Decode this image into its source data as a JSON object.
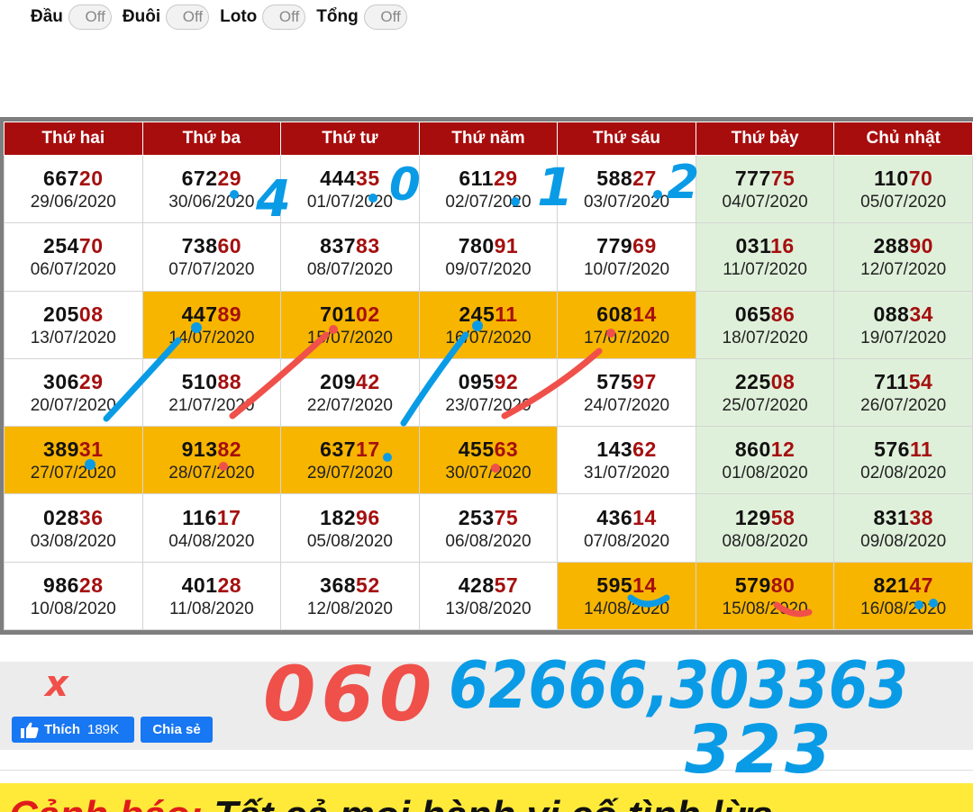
{
  "toggles": [
    {
      "label": "Đầu",
      "state": "Off"
    },
    {
      "label": "Đuôi",
      "state": "Off"
    },
    {
      "label": "Loto",
      "state": "Off"
    },
    {
      "label": "Tổng",
      "state": "Off"
    }
  ],
  "table": {
    "headers": [
      "Thứ hai",
      "Thứ ba",
      "Thứ tư",
      "Thứ năm",
      "Thứ sáu",
      "Thứ bảy",
      "Chủ nhật"
    ],
    "rows": [
      [
        {
          "head": "667",
          "tail": "20",
          "date": "29/06/2020"
        },
        {
          "head": "672",
          "tail": "29",
          "date": "30/06/2020"
        },
        {
          "head": "444",
          "tail": "35",
          "date": "01/07/2020"
        },
        {
          "head": "611",
          "tail": "29",
          "date": "02/07/2020"
        },
        {
          "head": "588",
          "tail": "27",
          "date": "03/07/2020"
        },
        {
          "head": "777",
          "tail": "75",
          "date": "04/07/2020"
        },
        {
          "head": "110",
          "tail": "70",
          "date": "05/07/2020"
        }
      ],
      [
        {
          "head": "254",
          "tail": "70",
          "date": "06/07/2020"
        },
        {
          "head": "738",
          "tail": "60",
          "date": "07/07/2020"
        },
        {
          "head": "837",
          "tail": "83",
          "date": "08/07/2020"
        },
        {
          "head": "780",
          "tail": "91",
          "date": "09/07/2020"
        },
        {
          "head": "779",
          "tail": "69",
          "date": "10/07/2020"
        },
        {
          "head": "031",
          "tail": "16",
          "date": "11/07/2020"
        },
        {
          "head": "288",
          "tail": "90",
          "date": "12/07/2020"
        }
      ],
      [
        {
          "head": "205",
          "tail": "08",
          "date": "13/07/2020"
        },
        {
          "head": "447",
          "tail": "89",
          "date": "14/07/2020",
          "hl": true
        },
        {
          "head": "701",
          "tail": "02",
          "date": "15/07/2020",
          "hl": true
        },
        {
          "head": "245",
          "tail": "11",
          "date": "16/07/2020",
          "hl": true
        },
        {
          "head": "608",
          "tail": "14",
          "date": "17/07/2020",
          "hl": true
        },
        {
          "head": "065",
          "tail": "86",
          "date": "18/07/2020"
        },
        {
          "head": "088",
          "tail": "34",
          "date": "19/07/2020"
        }
      ],
      [
        {
          "head": "306",
          "tail": "29",
          "date": "20/07/2020"
        },
        {
          "head": "510",
          "tail": "88",
          "date": "21/07/2020"
        },
        {
          "head": "209",
          "tail": "42",
          "date": "22/07/2020"
        },
        {
          "head": "095",
          "tail": "92",
          "date": "23/07/2020"
        },
        {
          "head": "575",
          "tail": "97",
          "date": "24/07/2020"
        },
        {
          "head": "225",
          "tail": "08",
          "date": "25/07/2020"
        },
        {
          "head": "711",
          "tail": "54",
          "date": "26/07/2020"
        }
      ],
      [
        {
          "head": "389",
          "tail": "31",
          "date": "27/07/2020",
          "hl": true
        },
        {
          "head": "913",
          "tail": "82",
          "date": "28/07/2020",
          "hl": true
        },
        {
          "head": "637",
          "tail": "17",
          "date": "29/07/2020",
          "hl": true
        },
        {
          "head": "455",
          "tail": "63",
          "date": "30/07/2020",
          "hl": true
        },
        {
          "head": "143",
          "tail": "62",
          "date": "31/07/2020"
        },
        {
          "head": "860",
          "tail": "12",
          "date": "01/08/2020"
        },
        {
          "head": "576",
          "tail": "11",
          "date": "02/08/2020"
        }
      ],
      [
        {
          "head": "028",
          "tail": "36",
          "date": "03/08/2020"
        },
        {
          "head": "116",
          "tail": "17",
          "date": "04/08/2020"
        },
        {
          "head": "182",
          "tail": "96",
          "date": "05/08/2020"
        },
        {
          "head": "253",
          "tail": "75",
          "date": "06/08/2020"
        },
        {
          "head": "436",
          "tail": "14",
          "date": "07/08/2020"
        },
        {
          "head": "129",
          "tail": "58",
          "date": "08/08/2020"
        },
        {
          "head": "831",
          "tail": "38",
          "date": "09/08/2020"
        }
      ],
      [
        {
          "head": "986",
          "tail": "28",
          "date": "10/08/2020"
        },
        {
          "head": "401",
          "tail": "28",
          "date": "11/08/2020"
        },
        {
          "head": "368",
          "tail": "52",
          "date": "12/08/2020"
        },
        {
          "head": "428",
          "tail": "57",
          "date": "13/08/2020"
        },
        {
          "head": "595",
          "tail": "14",
          "date": "14/08/2020",
          "hl": true
        },
        {
          "head": "579",
          "tail": "80",
          "date": "15/08/2020",
          "hl": true
        },
        {
          "head": "821",
          "tail": "47",
          "date": "16/08/2020",
          "hl": true
        }
      ]
    ]
  },
  "facebook": {
    "like_label": "Thích",
    "like_count": "189K",
    "share_label": "Chia sẻ"
  },
  "warning": {
    "title": "Cảnh báo:",
    "body": "Tất cả mọi hành vi cố tình lừa"
  },
  "handwriting": {
    "top_digits": [
      "4",
      "0",
      "1",
      "2"
    ],
    "red_mark": "x",
    "red_number": "060",
    "blue_line1": "62666,303363",
    "blue_line2": "323",
    "colors": {
      "blue": "#0a9be6",
      "red": "#f0504a"
    }
  },
  "colors": {
    "header_bg": "#a80d0d",
    "highlight": "#f7b500",
    "weekend": "#dff0da",
    "tail_digits": "#a50f0f",
    "facebook": "#1877f2",
    "warning_band": "#ffea3a"
  }
}
